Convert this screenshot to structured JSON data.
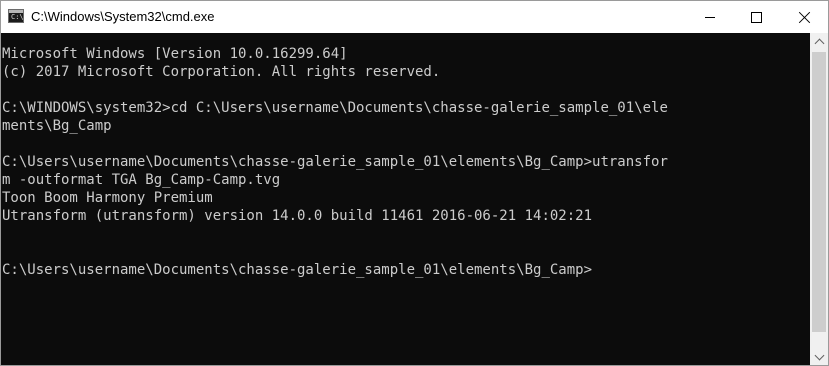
{
  "window": {
    "title": "C:\\Windows\\System32\\cmd.exe",
    "icon": "cmd-icon",
    "icon_glyph": "C:\\",
    "controls": {
      "minimize": "minimize-icon",
      "maximize": "maximize-icon",
      "close": "close-icon"
    }
  },
  "console": {
    "background": "#0c0c0c",
    "foreground": "#cccccc",
    "lines": [
      "Microsoft Windows [Version 10.0.16299.64]",
      "(c) 2017 Microsoft Corporation. All rights reserved.",
      "",
      "C:\\WINDOWS\\system32>cd C:\\Users\\username\\Documents\\chasse-galerie_sample_01\\ele",
      "ments\\Bg_Camp",
      "",
      "C:\\Users\\username\\Documents\\chasse-galerie_sample_01\\elements\\Bg_Camp>utransfor",
      "m -outformat TGA Bg_Camp-Camp.tvg",
      "Toon Boom Harmony Premium",
      "Utransform (utransform) version 14.0.0 build 11461 2016-06-21 14:02:21",
      "",
      "",
      "C:\\Users\\username\\Documents\\chasse-galerie_sample_01\\elements\\Bg_Camp>"
    ]
  },
  "scrollbar": {
    "up": "chevron-up-icon",
    "down": "chevron-down-icon"
  }
}
